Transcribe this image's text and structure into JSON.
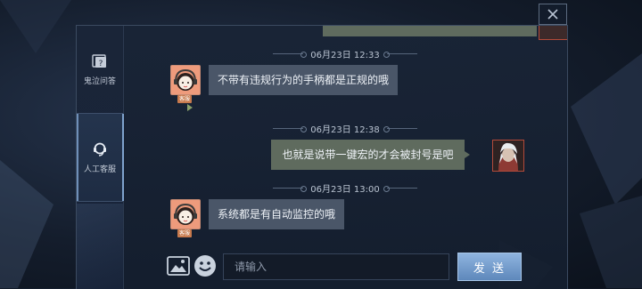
{
  "sidebar": {
    "items": [
      {
        "label": "鬼泣问答",
        "icon": "qa-book-icon",
        "active": false
      },
      {
        "label": "人工客服",
        "icon": "headset-icon",
        "active": true
      }
    ]
  },
  "messages": [
    {
      "time": "06月23日 12:33",
      "sender": "support",
      "text": "不带有违规行为的手柄都是正规的哦",
      "tag": "客服"
    },
    {
      "time": "06月23日 12:38",
      "sender": "user",
      "text": "也就是说带一键宏的才会被封号是吧"
    },
    {
      "time": "06月23日 13:00",
      "sender": "support",
      "text": "系统都是有自动监控的哦",
      "tag": "客服"
    }
  ],
  "input": {
    "placeholder": "请输入",
    "value": ""
  },
  "send_label": "发 送",
  "colors": {
    "support_bubble": "#4a5668",
    "user_bubble": "#5f6b5e",
    "send_button": "#6f97c8",
    "avatar_bg": "#e99878"
  },
  "icons": {
    "close": "close-icon",
    "image": "image-icon",
    "emoji": "emoji-icon"
  }
}
